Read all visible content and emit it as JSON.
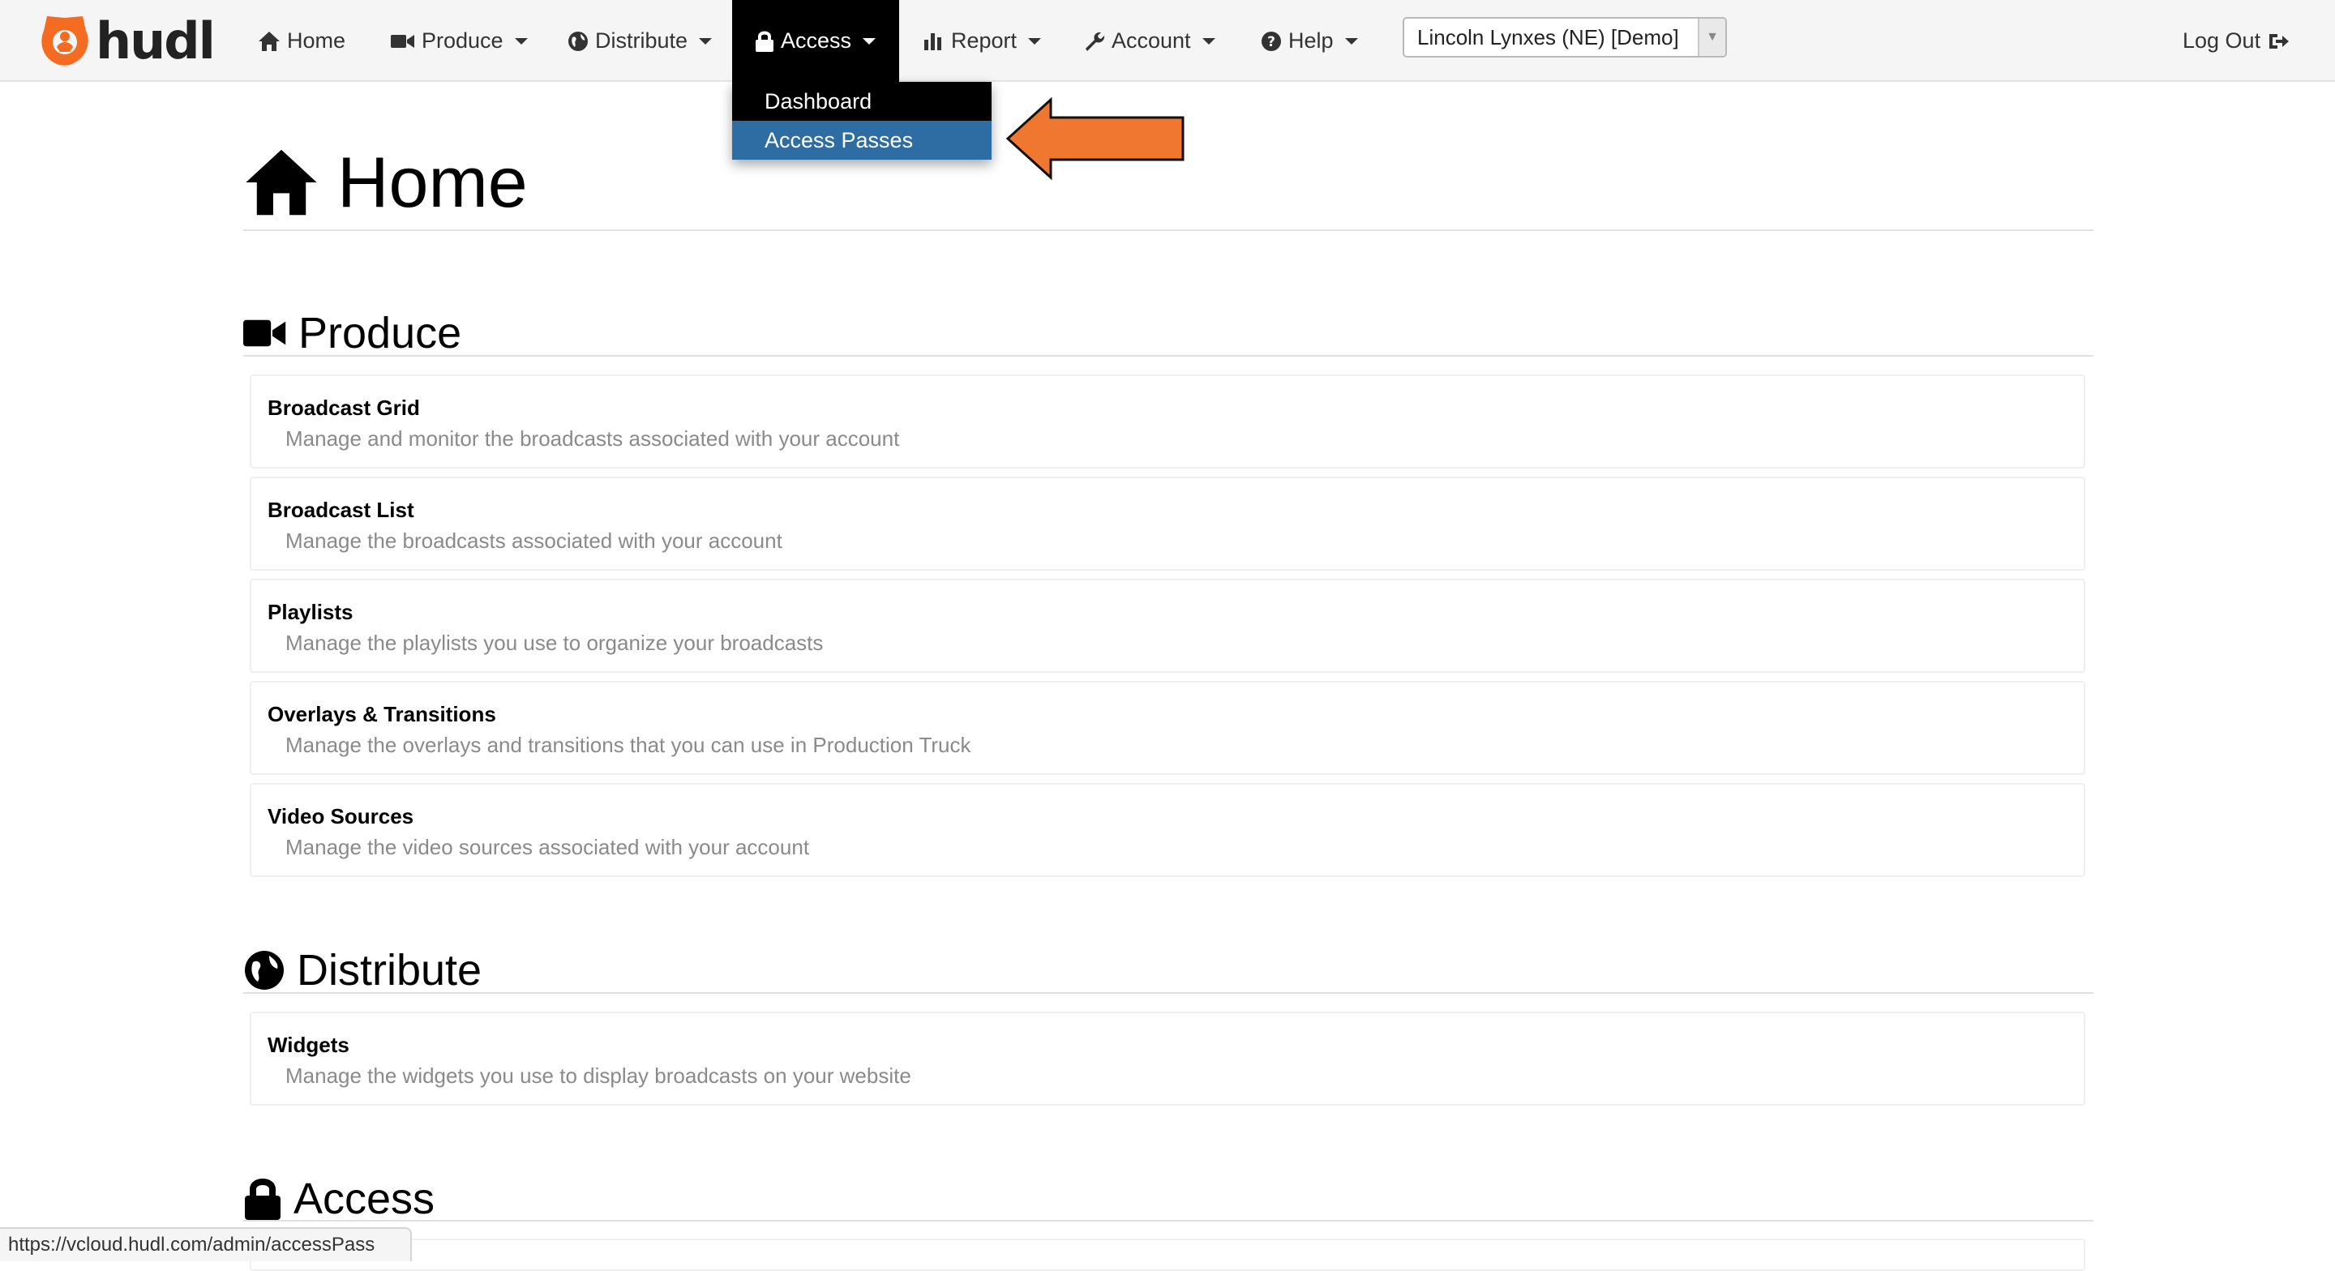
{
  "navbar": {
    "logo_text": "hudl",
    "items": [
      {
        "label": "Home",
        "icon": "home-icon"
      },
      {
        "label": "Produce",
        "icon": "video-camera-icon"
      },
      {
        "label": "Distribute",
        "icon": "globe-icon"
      },
      {
        "label": "Access",
        "icon": "lock-icon"
      },
      {
        "label": "Report",
        "icon": "bar-chart-icon"
      },
      {
        "label": "Account",
        "icon": "wrench-icon"
      },
      {
        "label": "Help",
        "icon": "question-circle-icon"
      }
    ],
    "org_select": {
      "value": "Lincoln Lynxes (NE) [Demo]"
    },
    "logout_label": "Log Out"
  },
  "access_dropdown": {
    "items": [
      {
        "label": "Dashboard"
      },
      {
        "label": "Access Passes"
      }
    ]
  },
  "page": {
    "title": "Home"
  },
  "sections": {
    "produce": {
      "title": "Produce",
      "cards": [
        {
          "title": "Broadcast Grid",
          "desc": "Manage and monitor the broadcasts associated with your account"
        },
        {
          "title": "Broadcast List",
          "desc": "Manage the broadcasts associated with your account"
        },
        {
          "title": "Playlists",
          "desc": "Manage the playlists you use to organize your broadcasts"
        },
        {
          "title": "Overlays & Transitions",
          "desc": "Manage the overlays and transitions that you can use in Production Truck"
        },
        {
          "title": "Video Sources",
          "desc": "Manage the video sources associated with your account"
        }
      ]
    },
    "distribute": {
      "title": "Distribute",
      "cards": [
        {
          "title": "Widgets",
          "desc": "Manage the widgets you use to display broadcasts on your website"
        }
      ]
    },
    "access": {
      "title": "Access"
    }
  },
  "status_bar": {
    "url": "https://vcloud.hudl.com/admin/accessPass"
  },
  "colors": {
    "brand_orange": "#f36c21",
    "navbar_bg": "#f5f5f5",
    "dropdown_bg": "#000000",
    "dropdown_active": "#2e6da4",
    "annotation_arrow": "#f07730"
  }
}
